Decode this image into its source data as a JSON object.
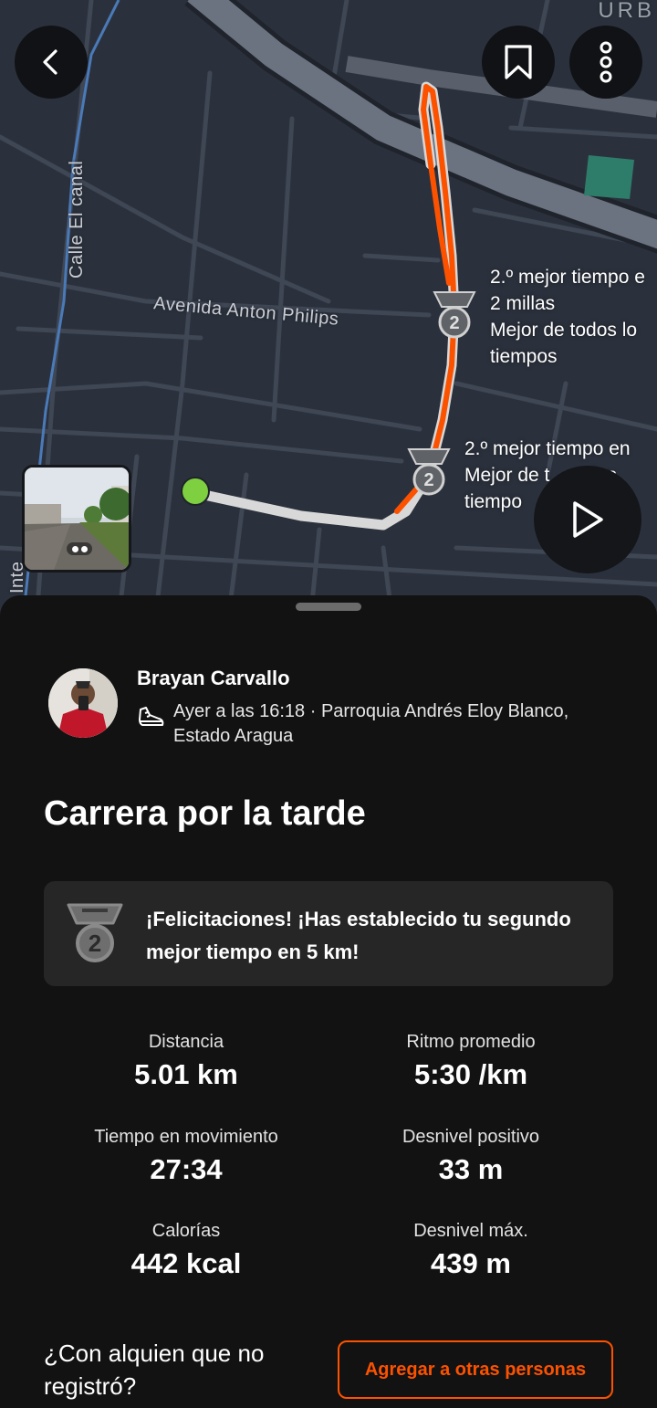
{
  "map": {
    "streets": {
      "calle_el_canal": "Calle El canal",
      "avenida_anton_philips": "Avenida Anton Philips",
      "urb": "URB",
      "inte": "Inte"
    },
    "achievements": [
      {
        "lines": [
          "2.º mejor tiempo e",
          "2 millas",
          "Mejor de todos lo",
          "tiempos"
        ]
      },
      {
        "lines": [
          "2.º mejor tiempo en",
          "Mejor de t        los",
          "tiempo"
        ]
      }
    ],
    "route_color": "#fc5200",
    "start_color": "#7ed040"
  },
  "icons": {
    "back": "back-arrow-icon",
    "bookmark": "bookmark-icon",
    "more": "more-vertical-icon",
    "play": "play-icon",
    "shoe": "running-shoe-icon",
    "medal": "medal-2-icon"
  },
  "activity": {
    "athlete": "Brayan Carvallo",
    "meta": "Ayer a las 16:18 · Parroquia Andrés Eloy Blanco, Estado Aragua",
    "title": "Carrera por la tarde"
  },
  "banner": {
    "text": "¡Felicitaciones! ¡Has establecido tu segundo mejor tiempo en 5 km!",
    "medal_rank": "2"
  },
  "stats": [
    {
      "label": "Distancia",
      "value": "5.01 km"
    },
    {
      "label": "Ritmo promedio",
      "value": "5:30 /km"
    },
    {
      "label": "Tiempo en movimiento",
      "value": "27:34"
    },
    {
      "label": "Desnivel positivo",
      "value": "33 m"
    },
    {
      "label": "Calorías",
      "value": "442 kcal"
    },
    {
      "label": "Desnivel máx.",
      "value": "439 m"
    }
  ],
  "footer": {
    "question": "¿Con alquien que no registró?",
    "add_button": "Agregar a otras personas"
  },
  "colors": {
    "accent": "#fc5200",
    "background": "#121212",
    "map_background": "#2b313c",
    "banner_background": "#262626"
  }
}
